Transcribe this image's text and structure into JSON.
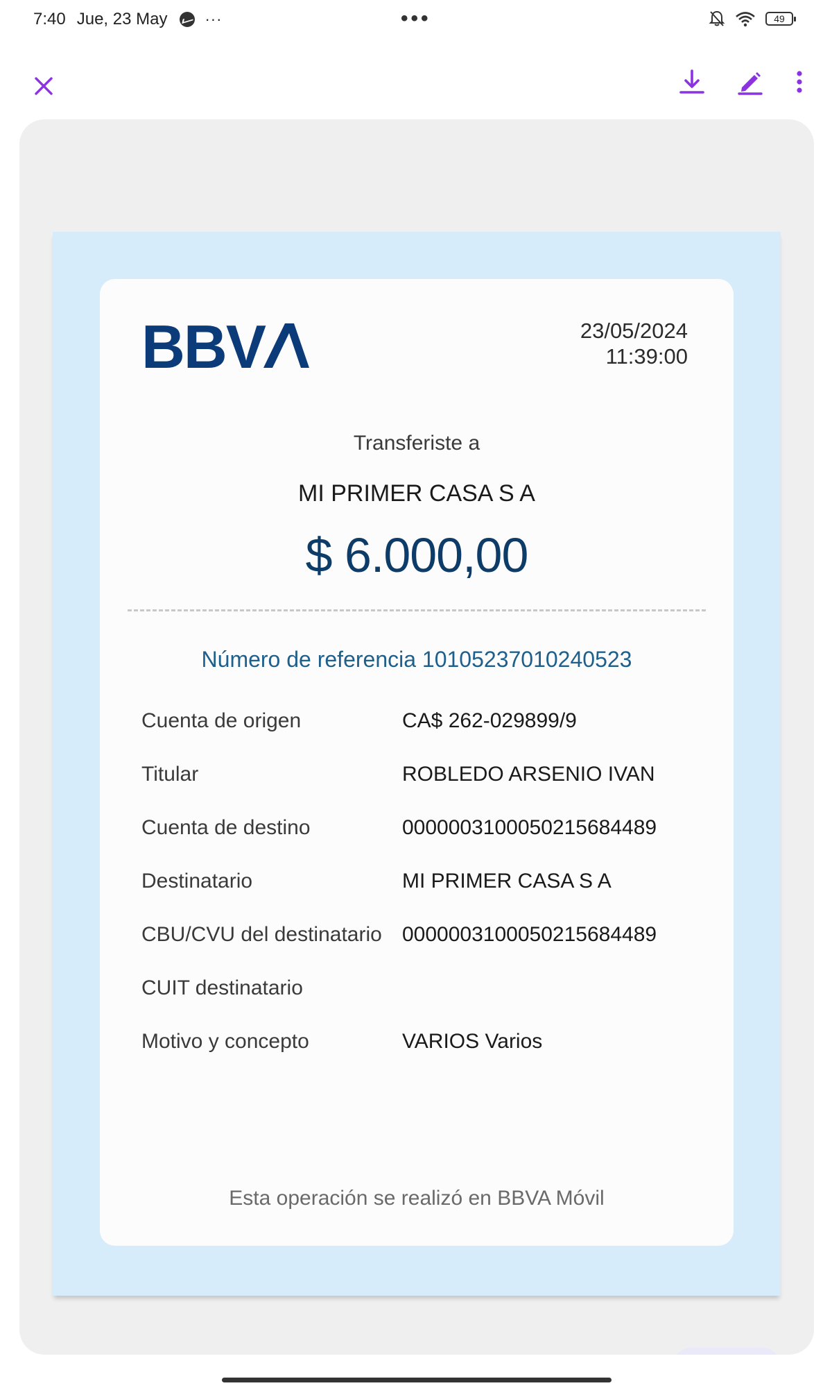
{
  "status_bar": {
    "time": "7:40",
    "date": "Jue, 23 May",
    "more": "···",
    "center_dots": "•••",
    "battery_level": "49",
    "icons": [
      "messenger-icon",
      "bell-off-icon",
      "wifi-icon",
      "battery-icon"
    ]
  },
  "toolbar": {
    "accent_color": "#8b33e0",
    "icons": [
      "close-icon",
      "download-icon",
      "edit-icon",
      "more-vertical-icon"
    ]
  },
  "receipt": {
    "brand": "BBVA",
    "brand_color": "#0b3b78",
    "date": "23/05/2024",
    "time": "11:39:00",
    "transfer_label": "Transferiste a",
    "recipient_name": "MI PRIMER CASA S A",
    "amount": "$ 6.000,00",
    "reference": "Número de referencia 10105237010240523",
    "details": [
      {
        "label": "Cuenta de origen",
        "value": "CA$ 262-029899/9"
      },
      {
        "label": "Titular",
        "value": "ROBLEDO ARSENIO IVAN"
      },
      {
        "label": "Cuenta de destino",
        "value": "0000003100050215684489"
      },
      {
        "label": "Destinatario",
        "value": "MI PRIMER CASA S A"
      },
      {
        "label": "CBU/CVU del destinatario",
        "value": "0000003100050215684489"
      },
      {
        "label": "CUIT destinatario",
        "value": ""
      },
      {
        "label": "Motivo y concepto",
        "value": "VARIOS Varios"
      }
    ],
    "footer": "Esta operación se realizó en BBVA Móvil"
  }
}
